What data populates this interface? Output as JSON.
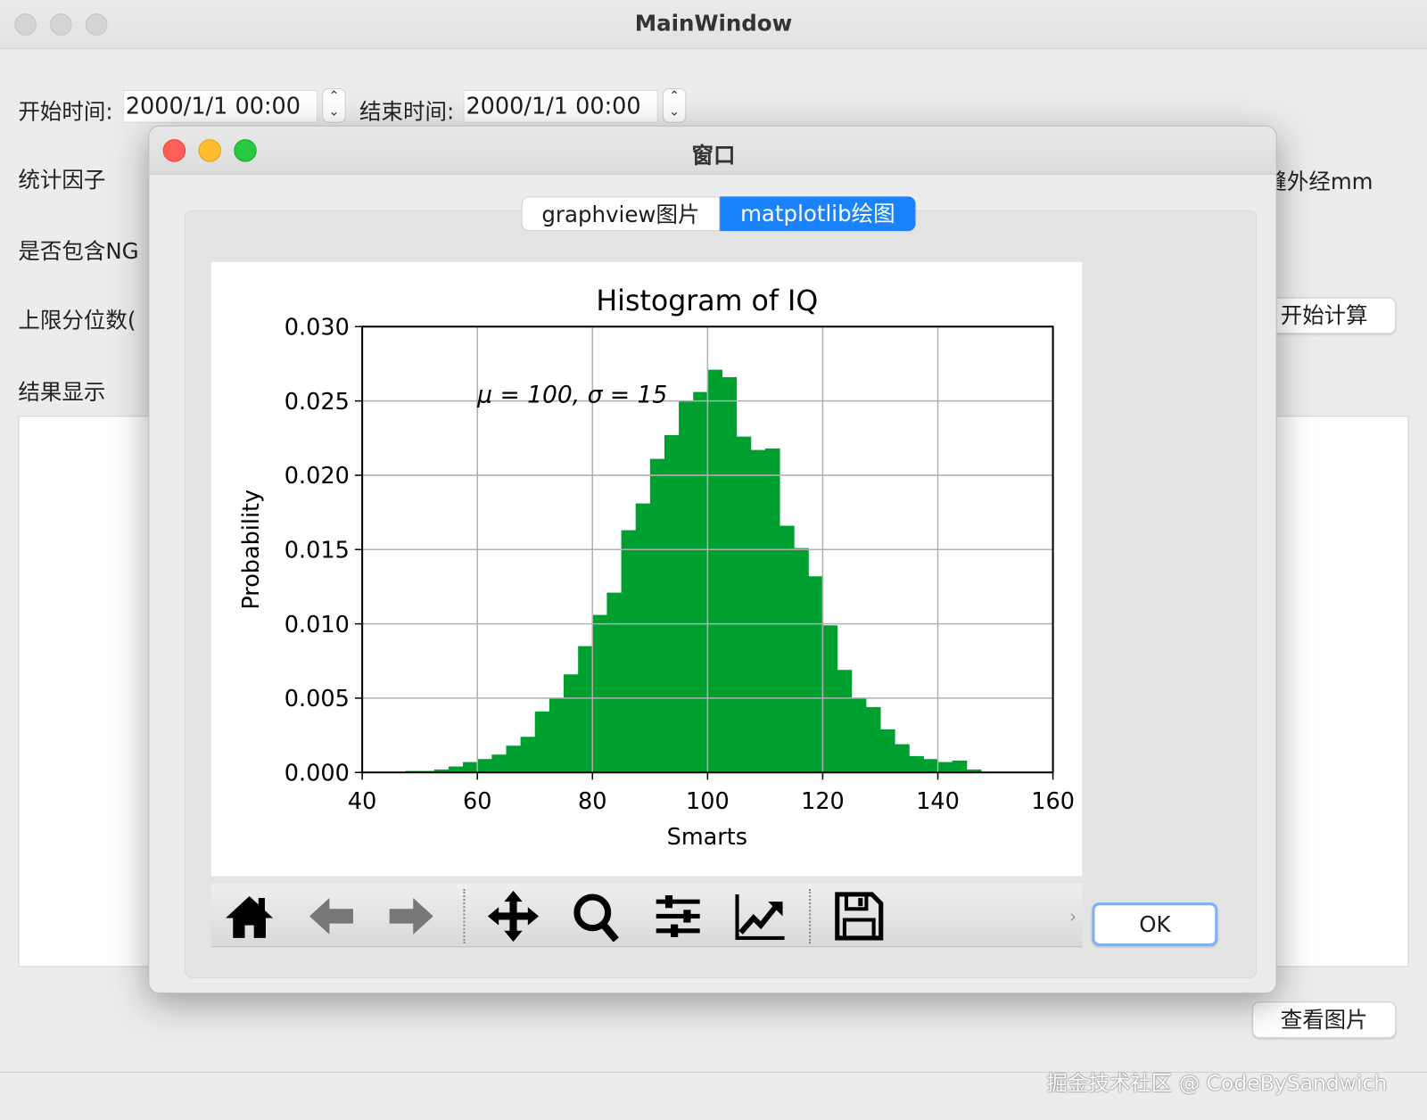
{
  "main_window": {
    "title": "MainWindow",
    "start_label": "开始时间:",
    "start_value": "2000/1/1 00:00",
    "end_label": "结束时间:",
    "end_value": "2000/1/1 00:00",
    "stat_factor_label": "统计因子",
    "include_ng_label": "是否包含NG",
    "upper_quantile_label": "上限分位数(",
    "result_label": "结果显示",
    "right_label": "缝外经mm",
    "start_calc_button": "开始计算",
    "view_image_button": "查看图片",
    "watermark": "掘金技术社区 @ CodeBySandwich"
  },
  "dialog": {
    "title": "窗口",
    "tabs": [
      {
        "label": "graphview图片",
        "active": false
      },
      {
        "label": "matplotlib绘图",
        "active": true
      }
    ],
    "ok_button": "OK",
    "toolbar": [
      "home-icon",
      "back-icon",
      "forward-icon",
      "pan-icon",
      "zoom-icon",
      "configure-subplots-icon",
      "edit-axis-icon",
      "save-icon"
    ]
  },
  "colors": {
    "bar": "#00a030",
    "accent": "#1a82fb"
  },
  "chart_data": {
    "type": "bar",
    "title": "Histogram of IQ",
    "xlabel": "Smarts",
    "ylabel": "Probability",
    "annotation": "μ = 100,  σ = 15",
    "annotation_at": [
      60,
      0.025
    ],
    "xlim": [
      40,
      160
    ],
    "ylim": [
      0,
      0.03
    ],
    "xticks": [
      "40",
      "60",
      "80",
      "100",
      "120",
      "140",
      "160"
    ],
    "yticks": [
      "0.000",
      "0.005",
      "0.010",
      "0.015",
      "0.020",
      "0.025",
      "0.030"
    ],
    "grid": true,
    "bin_width": 2.5,
    "bin_left_edges": [
      47.5,
      50,
      52.5,
      55,
      57.5,
      60,
      62.5,
      65,
      67.5,
      70,
      72.5,
      75,
      77.5,
      80,
      82.5,
      85,
      87.5,
      90,
      92.5,
      95,
      97.5,
      100,
      102.5,
      105,
      107.5,
      110,
      112.5,
      115,
      117.5,
      120,
      122.5,
      125,
      127.5,
      130,
      132.5,
      135,
      137.5,
      140,
      142.5,
      145
    ],
    "values": [
      0.0001,
      0.0001,
      0.0002,
      0.0004,
      0.0007,
      0.0009,
      0.0012,
      0.0018,
      0.0024,
      0.0041,
      0.005,
      0.0066,
      0.0085,
      0.0106,
      0.0121,
      0.0163,
      0.0181,
      0.0211,
      0.0227,
      0.025,
      0.0256,
      0.0271,
      0.0266,
      0.0226,
      0.0217,
      0.0218,
      0.0166,
      0.0151,
      0.0132,
      0.0099,
      0.0069,
      0.005,
      0.0044,
      0.0029,
      0.0019,
      0.0011,
      0.0009,
      0.0007,
      0.0008,
      0.0002
    ]
  }
}
